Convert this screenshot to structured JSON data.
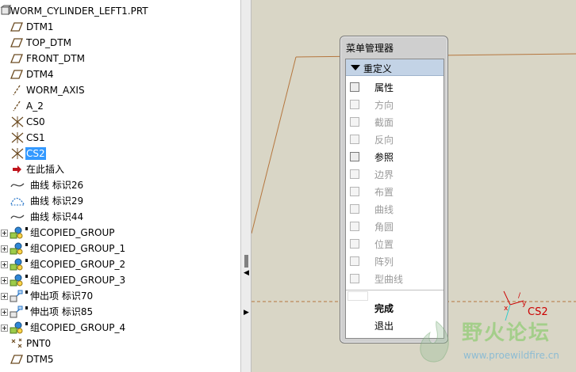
{
  "tree": {
    "root": "WORM_CYLINDER_LEFT1.PRT",
    "items": [
      {
        "label": "DTM1",
        "icon": "datum-plane-icon"
      },
      {
        "label": "TOP_DTM",
        "icon": "datum-plane-icon"
      },
      {
        "label": "FRONT_DTM",
        "icon": "datum-plane-icon"
      },
      {
        "label": "DTM4",
        "icon": "datum-plane-icon"
      },
      {
        "label": "WORM_AXIS",
        "icon": "datum-axis-icon"
      },
      {
        "label": "A_2",
        "icon": "datum-axis-icon"
      },
      {
        "label": "CS0",
        "icon": "coordinate-system-icon"
      },
      {
        "label": "CS1",
        "icon": "coordinate-system-icon"
      },
      {
        "label": "CS2",
        "icon": "coordinate-system-icon",
        "selected": true
      },
      {
        "label": "在此插入",
        "icon": "insert-here-arrow-icon"
      },
      {
        "label": "曲线 标识26",
        "icon": "curve-icon"
      },
      {
        "label": "曲线 标识29",
        "icon": "curve-dashed-icon"
      },
      {
        "label": "曲线 标识44",
        "icon": "curve-icon"
      },
      {
        "label": "组COPIED_GROUP",
        "icon": "group-icon"
      },
      {
        "label": "组COPIED_GROUP_1",
        "icon": "group-icon"
      },
      {
        "label": "组COPIED_GROUP_2",
        "icon": "group-icon"
      },
      {
        "label": "组COPIED_GROUP_3",
        "icon": "group-icon"
      },
      {
        "label": "伸出项 标识70",
        "icon": "protrusion-icon"
      },
      {
        "label": "伸出项 标识85",
        "icon": "protrusion-icon"
      },
      {
        "label": "组COPIED_GROUP_4",
        "icon": "group-icon"
      },
      {
        "label": "PNT0",
        "icon": "datum-point-icon"
      },
      {
        "label": "DTM5",
        "icon": "datum-plane-icon"
      }
    ]
  },
  "menu": {
    "title": "菜单管理器",
    "section": "重定义",
    "options": [
      {
        "label": "属性",
        "enabled": true
      },
      {
        "label": "方向",
        "enabled": false
      },
      {
        "label": "截面",
        "enabled": false
      },
      {
        "label": "反向",
        "enabled": false
      },
      {
        "label": "参照",
        "enabled": true
      },
      {
        "label": "边界",
        "enabled": false
      },
      {
        "label": "布置",
        "enabled": false
      },
      {
        "label": "曲线",
        "enabled": false
      },
      {
        "label": "角圆",
        "enabled": false
      },
      {
        "label": "位置",
        "enabled": false
      },
      {
        "label": "阵列",
        "enabled": false
      },
      {
        "label": "型曲线",
        "enabled": false
      }
    ],
    "done": "完成",
    "quit": "退出"
  },
  "viewport": {
    "csys_label": "CS2",
    "background_color": "#d9d6c6",
    "edge_color": "#b5763e"
  },
  "watermark": {
    "text": "野火论坛",
    "url": "www.proewildfire.cn"
  }
}
